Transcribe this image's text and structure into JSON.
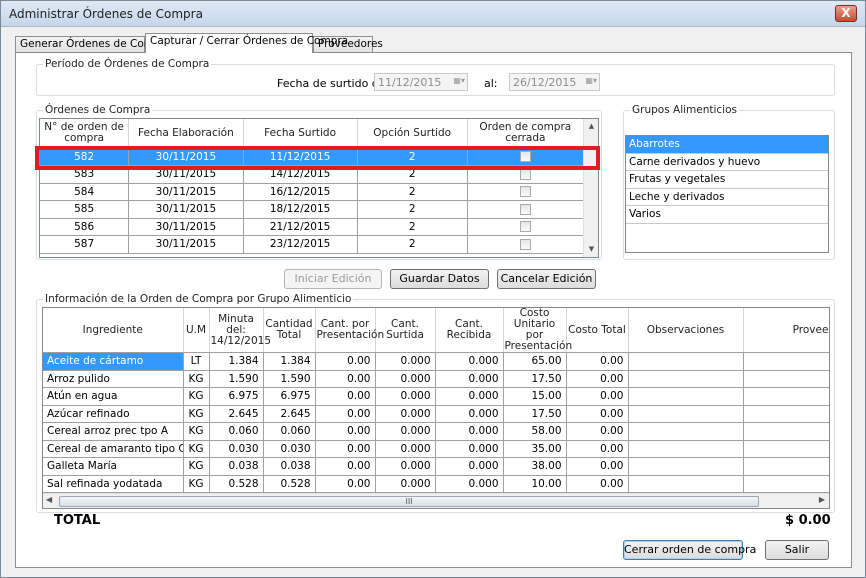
{
  "window": {
    "title": "Administrar Órdenes de Compra",
    "close": "X"
  },
  "tabs": [
    {
      "label": "Generar Órdenes de Compra."
    },
    {
      "label": "Capturar / Cerrar Órdenes de Compra"
    },
    {
      "label": "Proveedores"
    }
  ],
  "periodo": {
    "legend": "Período de Órdenes de Compra",
    "fecha_label": "Fecha de surtido del:",
    "fecha_desde": "11/12/2015",
    "al_label": "al:",
    "fecha_hasta": "26/12/2015"
  },
  "ordenes": {
    "legend": "Órdenes de Compra",
    "headers": [
      "N° de orden de compra",
      "Fecha Elaboración",
      "Fecha Surtido",
      "Opción Surtido",
      "Orden de compra cerrada"
    ],
    "rows": [
      [
        "582",
        "30/11/2015",
        "11/12/2015",
        "2"
      ],
      [
        "583",
        "30/11/2015",
        "14/12/2015",
        "2"
      ],
      [
        "584",
        "30/11/2015",
        "16/12/2015",
        "2"
      ],
      [
        "585",
        "30/11/2015",
        "18/12/2015",
        "2"
      ],
      [
        "586",
        "30/11/2015",
        "21/12/2015",
        "2"
      ],
      [
        "587",
        "30/11/2015",
        "23/12/2015",
        "2"
      ]
    ]
  },
  "grupos": {
    "legend": "Grupos Alimenticios",
    "items": [
      "Abarrotes",
      "Carne derivados y huevo",
      "Frutas y vegetales",
      "Leche y derivados",
      "Varios"
    ]
  },
  "buttons": {
    "iniciar": "Iniciar Edición",
    "guardar": "Guardar Datos",
    "cancelar": "Cancelar Edición",
    "cerrar_orden": "Cerrar orden de compra",
    "salir": "Salir"
  },
  "info": {
    "legend": "Información de la Orden de Compra por Grupo Alimenticio",
    "headers": [
      "Ingrediente",
      "U.M",
      "Minuta del: 14/12/2015",
      "Cantidad Total",
      "Cant. por Presentación",
      "Cant. Surtida",
      "Cant. Recibida",
      "Costo Unitario por Presentación",
      "Costo Total",
      "Observaciones",
      "Proveedo"
    ],
    "rows": [
      [
        "Aceite de cártamo",
        "LT",
        "1.384",
        "1.384",
        "0.00",
        "0.000",
        "0.000",
        "65.00",
        "0.00"
      ],
      [
        "Arroz pulido",
        "KG",
        "1.590",
        "1.590",
        "0.00",
        "0.000",
        "0.000",
        "17.50",
        "0.00"
      ],
      [
        "Atún en agua",
        "KG",
        "6.975",
        "6.975",
        "0.00",
        "0.000",
        "0.000",
        "15.00",
        "0.00"
      ],
      [
        "Azúcar refinado",
        "KG",
        "2.645",
        "2.645",
        "0.00",
        "0.000",
        "0.000",
        "17.50",
        "0.00"
      ],
      [
        "Cereal arroz prec tpo A",
        "KG",
        "0.060",
        "0.060",
        "0.00",
        "0.000",
        "0.000",
        "58.00",
        "0.00"
      ],
      [
        "Cereal de amaranto tipo C",
        "KG",
        "0.030",
        "0.030",
        "0.00",
        "0.000",
        "0.000",
        "35.00",
        "0.00"
      ],
      [
        "Galleta María",
        "KG",
        "0.038",
        "0.038",
        "0.00",
        "0.000",
        "0.000",
        "38.00",
        "0.00"
      ],
      [
        "Sal refinada yodatada",
        "KG",
        "0.528",
        "0.528",
        "0.00",
        "0.000",
        "0.000",
        "10.00",
        "0.00"
      ]
    ],
    "scroll_thumb": "III"
  },
  "totals": {
    "label": "TOTAL",
    "value": "$ 0.00"
  },
  "colors": {
    "selection": "#3399ff",
    "highlight": "#e01b24"
  }
}
